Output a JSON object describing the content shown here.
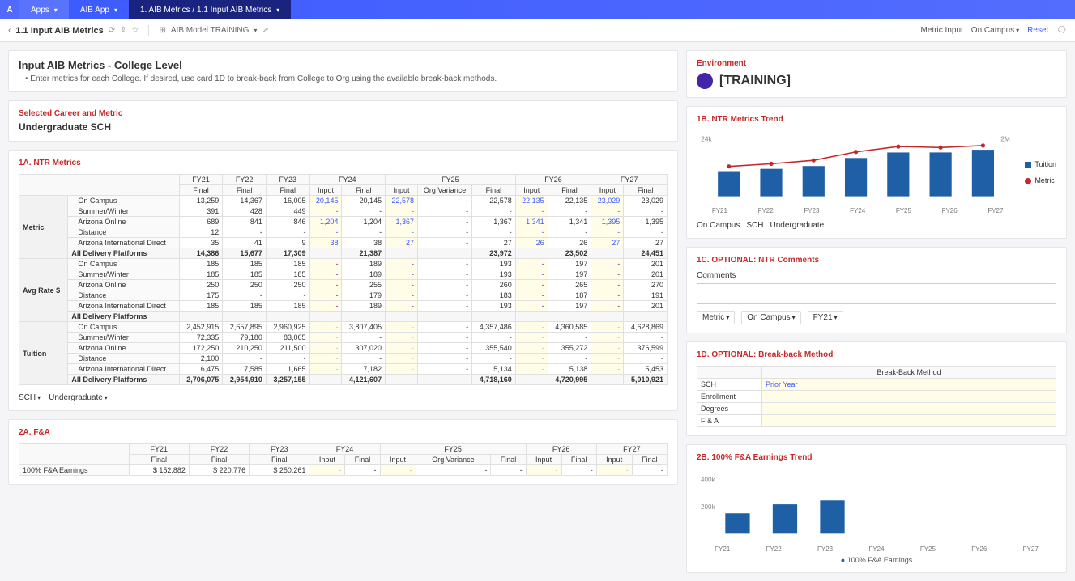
{
  "topbar": {
    "apps": "Apps",
    "app_name": "AIB App",
    "breadcrumb": "1. AIB Metrics / 1.1 Input AIB Metrics"
  },
  "subbar": {
    "title": "1.1 Input AIB Metrics",
    "model": "AIB Model TRAINING",
    "metric_input": "Metric Input",
    "on_campus": "On Campus",
    "reset": "Reset"
  },
  "header": {
    "title": "Input AIB Metrics - College Level",
    "sub": "Enter metrics for each College. If desired, use card 1D to break-back from College to Org using the available break-back methods."
  },
  "selected": {
    "label": "Selected Career and Metric",
    "value": "Undergraduate SCH"
  },
  "ntr": {
    "title": "1A. NTR Metrics",
    "year_headers": [
      "FY21",
      "FY22",
      "FY23",
      "FY24",
      "FY25",
      "FY26",
      "FY27"
    ],
    "sub_headers_simple": "Final",
    "sub_headers_input": "Input",
    "sub_headers_orgvar": "Org Variance",
    "groups": [
      {
        "name": "Metric",
        "rows": [
          {
            "label": "On Campus",
            "fy21": "13,259",
            "fy22": "14,367",
            "fy23": "16,005",
            "fy24in": "20,145",
            "fy24fin": "20,145",
            "fy25in": "22,578",
            "fy25ov": "-",
            "fy25fin": "22,578",
            "fy26in": "22,135",
            "fy26fin": "22,135",
            "fy27in": "23,029",
            "fy27fin": "23,029"
          },
          {
            "label": "Summer/Winter",
            "fy21": "391",
            "fy22": "428",
            "fy23": "449",
            "fy24in": "-",
            "fy24fin": "-",
            "fy25in": "-",
            "fy25ov": "-",
            "fy25fin": "-",
            "fy26in": "-",
            "fy26fin": "-",
            "fy27in": "-",
            "fy27fin": "-"
          },
          {
            "label": "Arizona Online",
            "fy21": "689",
            "fy22": "841",
            "fy23": "846",
            "fy24in": "1,204",
            "fy24fin": "1,204",
            "fy25in": "1,367",
            "fy25ov": "-",
            "fy25fin": "1,367",
            "fy26in": "1,341",
            "fy26fin": "1,341",
            "fy27in": "1,395",
            "fy27fin": "1,395"
          },
          {
            "label": "Distance",
            "fy21": "12",
            "fy22": "-",
            "fy23": "-",
            "fy24in": "-",
            "fy24fin": "-",
            "fy25in": "-",
            "fy25ov": "-",
            "fy25fin": "-",
            "fy26in": "-",
            "fy26fin": "-",
            "fy27in": "-",
            "fy27fin": "-"
          },
          {
            "label": "Arizona International Direct",
            "fy21": "35",
            "fy22": "41",
            "fy23": "9",
            "fy24in": "38",
            "fy24fin": "38",
            "fy25in": "27",
            "fy25ov": "-",
            "fy25fin": "27",
            "fy26in": "26",
            "fy26fin": "26",
            "fy27in": "27",
            "fy27fin": "27"
          }
        ],
        "total": {
          "label": "All Delivery Platforms",
          "fy21": "14,386",
          "fy22": "15,677",
          "fy23": "17,309",
          "fy24fin": "21,387",
          "fy25fin": "23,972",
          "fy26fin": "23,502",
          "fy27fin": "24,451"
        }
      },
      {
        "name": "Avg Rate $",
        "rows": [
          {
            "label": "On Campus",
            "fy21": "185",
            "fy22": "185",
            "fy23": "185",
            "fy24in": "-",
            "fy24fin": "189",
            "fy25in": "-",
            "fy25ov": "-",
            "fy25fin": "193",
            "fy26in": "-",
            "fy26fin": "197",
            "fy27in": "-",
            "fy27fin": "201"
          },
          {
            "label": "Summer/Winter",
            "fy21": "185",
            "fy22": "185",
            "fy23": "185",
            "fy24in": "-",
            "fy24fin": "189",
            "fy25in": "-",
            "fy25ov": "-",
            "fy25fin": "193",
            "fy26in": "-",
            "fy26fin": "197",
            "fy27in": "-",
            "fy27fin": "201"
          },
          {
            "label": "Arizona Online",
            "fy21": "250",
            "fy22": "250",
            "fy23": "250",
            "fy24in": "-",
            "fy24fin": "255",
            "fy25in": "-",
            "fy25ov": "-",
            "fy25fin": "260",
            "fy26in": "-",
            "fy26fin": "265",
            "fy27in": "-",
            "fy27fin": "270"
          },
          {
            "label": "Distance",
            "fy21": "175",
            "fy22": "-",
            "fy23": "-",
            "fy24in": "-",
            "fy24fin": "179",
            "fy25in": "-",
            "fy25ov": "-",
            "fy25fin": "183",
            "fy26in": "-",
            "fy26fin": "187",
            "fy27in": "-",
            "fy27fin": "191"
          },
          {
            "label": "Arizona International Direct",
            "fy21": "185",
            "fy22": "185",
            "fy23": "185",
            "fy24in": "-",
            "fy24fin": "189",
            "fy25in": "-",
            "fy25ov": "-",
            "fy25fin": "193",
            "fy26in": "-",
            "fy26fin": "197",
            "fy27in": "-",
            "fy27fin": "201"
          }
        ],
        "total": {
          "label": "All Delivery Platforms"
        }
      },
      {
        "name": "Tuition",
        "rows": [
          {
            "label": "On Campus",
            "fy21": "2,452,915",
            "fy22": "2,657,895",
            "fy23": "2,960,925",
            "fy24in": "-",
            "fy24fin": "3,807,405",
            "fy25in": "-",
            "fy25ov": "-",
            "fy25fin": "4,357,486",
            "fy26in": "-",
            "fy26fin": "4,360,585",
            "fy27in": "-",
            "fy27fin": "4,628,869"
          },
          {
            "label": "Summer/Winter",
            "fy21": "72,335",
            "fy22": "79,180",
            "fy23": "83,065",
            "fy24in": "-",
            "fy24fin": "-",
            "fy25in": "-",
            "fy25ov": "-",
            "fy25fin": "-",
            "fy26in": "-",
            "fy26fin": "-",
            "fy27in": "-",
            "fy27fin": "-"
          },
          {
            "label": "Arizona Online",
            "fy21": "172,250",
            "fy22": "210,250",
            "fy23": "211,500",
            "fy24in": "-",
            "fy24fin": "307,020",
            "fy25in": "-",
            "fy25ov": "-",
            "fy25fin": "355,540",
            "fy26in": "-",
            "fy26fin": "355,272",
            "fy27in": "-",
            "fy27fin": "376,599"
          },
          {
            "label": "Distance",
            "fy21": "2,100",
            "fy22": "-",
            "fy23": "-",
            "fy24in": "-",
            "fy24fin": "-",
            "fy25in": "-",
            "fy25ov": "-",
            "fy25fin": "-",
            "fy26in": "-",
            "fy26fin": "-",
            "fy27in": "-",
            "fy27fin": "-"
          },
          {
            "label": "Arizona International Direct",
            "fy21": "6,475",
            "fy22": "7,585",
            "fy23": "1,665",
            "fy24in": "-",
            "fy24fin": "7,182",
            "fy25in": "-",
            "fy25ov": "-",
            "fy25fin": "5,134",
            "fy26in": "-",
            "fy26fin": "5,138",
            "fy27in": "-",
            "fy27fin": "5,453"
          }
        ],
        "total": {
          "label": "All Delivery Platforms",
          "fy21": "2,706,075",
          "fy22": "2,954,910",
          "fy23": "3,257,155",
          "fy24fin": "4,121,607",
          "fy25fin": "4,718,160",
          "fy26fin": "4,720,995",
          "fy27fin": "5,010,921"
        }
      }
    ],
    "pager1": "SCH",
    "pager2": "Undergraduate"
  },
  "fa": {
    "title": "2A. F&A",
    "year_headers": [
      "FY21",
      "FY22",
      "FY23",
      "FY24",
      "FY25",
      "FY26",
      "FY27"
    ],
    "row_label": "100% F&A Earnings",
    "vals": {
      "fy21": "$ 152,882",
      "fy22": "$ 220,776",
      "fy23": "$ 250,261"
    }
  },
  "env": {
    "label": "Environment",
    "name": "[TRAINING]"
  },
  "trend": {
    "title": "1B. NTR Metrics Trend",
    "legend_tuition": "Tuition",
    "legend_metric": "Metric",
    "selectors": {
      "a": "On Campus",
      "b": "SCH",
      "c": "Undergraduate"
    },
    "y_right": "2M",
    "y_left": "24k",
    "categories": [
      "FY21",
      "FY22",
      "FY23",
      "FY24",
      "FY25",
      "FY26",
      "FY27"
    ]
  },
  "comments": {
    "title": "1C. OPTIONAL: NTR Comments",
    "label": "Comments",
    "filters": {
      "a": "Metric",
      "b": "On Campus",
      "c": "FY21"
    }
  },
  "breakback": {
    "title": "1D. OPTIONAL: Break-back Method",
    "header": "Break-Back Method",
    "rows": [
      {
        "label": "SCH",
        "val": "Prior Year"
      },
      {
        "label": "Enrollment",
        "val": ""
      },
      {
        "label": "Degrees",
        "val": ""
      },
      {
        "label": "F & A",
        "val": ""
      }
    ]
  },
  "fatrend": {
    "title": "2B. 100% F&A Earnings Trend",
    "legend": "100% F&A Earnings",
    "categories": [
      "FY21",
      "FY22",
      "FY23",
      "FY24",
      "FY25",
      "FY26",
      "FY27"
    ],
    "y_label": "400k",
    "y_label2": "200k"
  },
  "chart_data": [
    {
      "type": "bar-line",
      "title": "NTR Metrics Trend",
      "categories": [
        "FY21",
        "FY22",
        "FY23",
        "FY24",
        "FY25",
        "FY26",
        "FY27"
      ],
      "series": [
        {
          "name": "Tuition",
          "type": "bar",
          "values": [
            2706075,
            2954910,
            3257155,
            4121607,
            4718160,
            4720995,
            5010921
          ],
          "axis": "right"
        },
        {
          "name": "Metric",
          "type": "line",
          "values": [
            14386,
            15677,
            17309,
            21387,
            23972,
            23502,
            24451
          ],
          "axis": "left"
        }
      ],
      "ylim_left": [
        0,
        24000
      ],
      "ylim_right": [
        0,
        6000000
      ]
    },
    {
      "type": "bar",
      "title": "100% F&A Earnings Trend",
      "categories": [
        "FY21",
        "FY22",
        "FY23",
        "FY24",
        "FY25",
        "FY26",
        "FY27"
      ],
      "values": [
        152882,
        220776,
        250261,
        0,
        0,
        0,
        0
      ],
      "ylim": [
        0,
        400000
      ]
    }
  ]
}
